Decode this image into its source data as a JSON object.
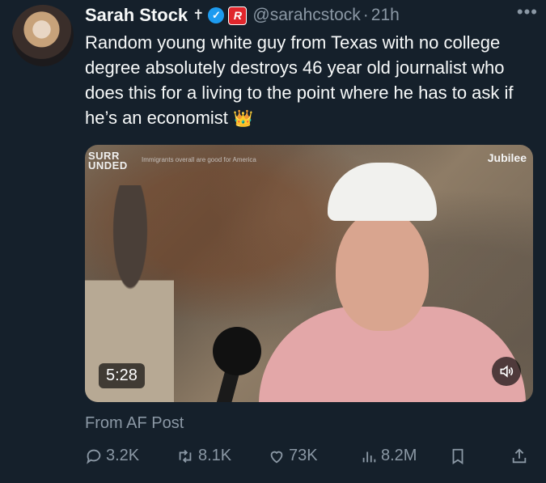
{
  "author": {
    "name": "Sarah Stock",
    "handle": "@sarahcstock",
    "separator": "·",
    "time": "21h",
    "cross_glyph": "✝",
    "verified_glyph": "✓",
    "badge_glyph": "R"
  },
  "tweet": {
    "text": "Random young white guy from Texas with no college degree absolutely destroys 46 year old journalist who does this for a living to the point where he has to ask if he’s an economist",
    "emoji": "👑"
  },
  "media": {
    "brand_line1": "SURR",
    "brand_line2": "UNDED",
    "caption": "Immigrants overall are good for America",
    "watermark": "Jubilee",
    "duration": "5:28"
  },
  "source": "From AF Post",
  "actions": {
    "replies": "3.2K",
    "reposts": "8.1K",
    "likes": "73K",
    "views": "8.2M"
  },
  "colors": {
    "background": "#15202b",
    "primary_text": "#f7f9f9",
    "secondary_text": "#8b98a5",
    "verified": "#1d9bf0",
    "badge": "#e0262c"
  }
}
